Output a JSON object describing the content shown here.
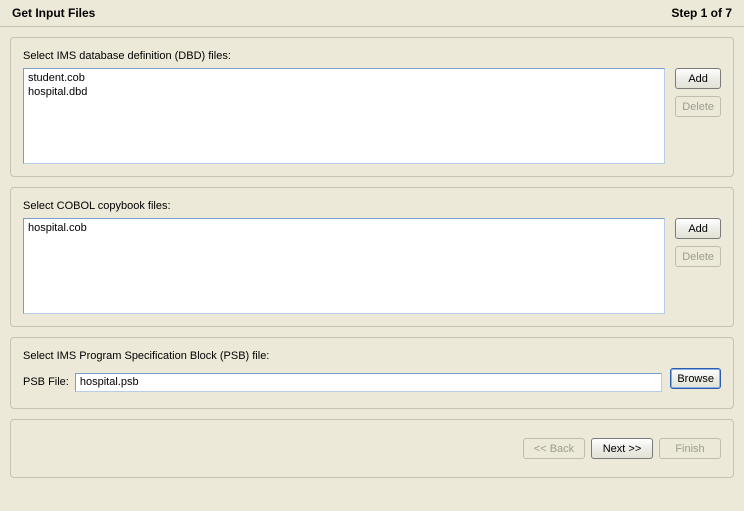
{
  "header": {
    "title": "Get Input Files",
    "step": "Step 1 of 7"
  },
  "dbd": {
    "label": "Select IMS database definition (DBD) files:",
    "items": "student.cob\nhospital.dbd",
    "add_label": "Add",
    "delete_label": "Delete"
  },
  "cobol": {
    "label": "Select COBOL copybook files:",
    "items": "hospital.cob",
    "add_label": "Add",
    "delete_label": "Delete"
  },
  "psb": {
    "label": "Select IMS Program Specification Block (PSB) file:",
    "field_label": "PSB File:",
    "value": "hospital.psb",
    "browse_label": "Browse"
  },
  "nav": {
    "back": "<< Back",
    "next": "Next >>",
    "finish": "Finish"
  }
}
